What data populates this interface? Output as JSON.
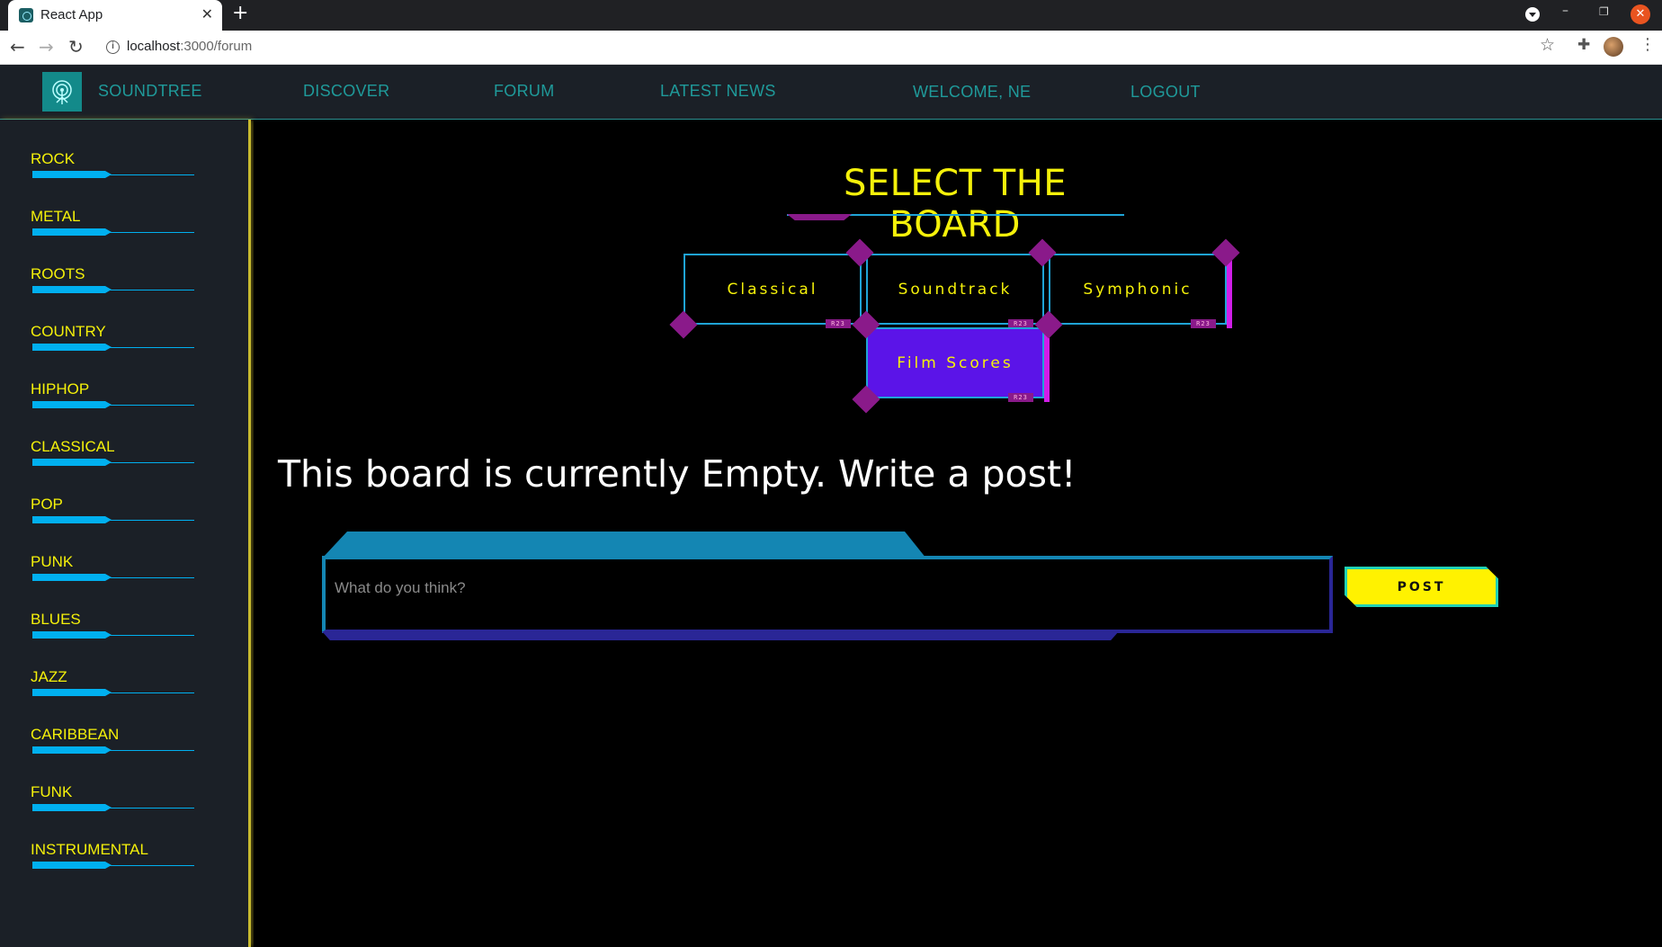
{
  "browser": {
    "tab_title": "React App",
    "tab_close": "✕",
    "new_tab": "+",
    "url_host": "localhost",
    "url_path": ":3000/forum"
  },
  "header": {
    "brand": "SOUNDTREE",
    "nav": [
      "DISCOVER",
      "FORUM",
      "LATEST NEWS"
    ],
    "welcome": "WELCOME, NE",
    "logout": "LOGOUT"
  },
  "sidebar": {
    "genres": [
      "ROCK",
      "METAL",
      "ROOTS",
      "COUNTRY",
      "HIPHOP",
      "CLASSICAL",
      "POP",
      "PUNK",
      "BLUES",
      "JAZZ",
      "CARIBBEAN",
      "FUNK",
      "INSTRUMENTAL"
    ]
  },
  "main": {
    "title": "SELECT THE BOARD",
    "boards": [
      {
        "label": "Classical",
        "tag": "R23"
      },
      {
        "label": "Soundtrack",
        "tag": "R23"
      },
      {
        "label": "Symphonic",
        "tag": "R23"
      },
      {
        "label": "Film Scores",
        "tag": "R23",
        "active": true
      }
    ],
    "empty_message": "This board is currently Empty. Write a post!",
    "post_placeholder": "What do you think?",
    "post_button": "POST"
  },
  "colors": {
    "accent_yellow": "#f5f10a",
    "accent_blue": "#1fa4d6",
    "accent_purple": "#5b14e8",
    "accent_magenta": "#8a1a8a",
    "nav_teal": "#1f9a9a"
  }
}
